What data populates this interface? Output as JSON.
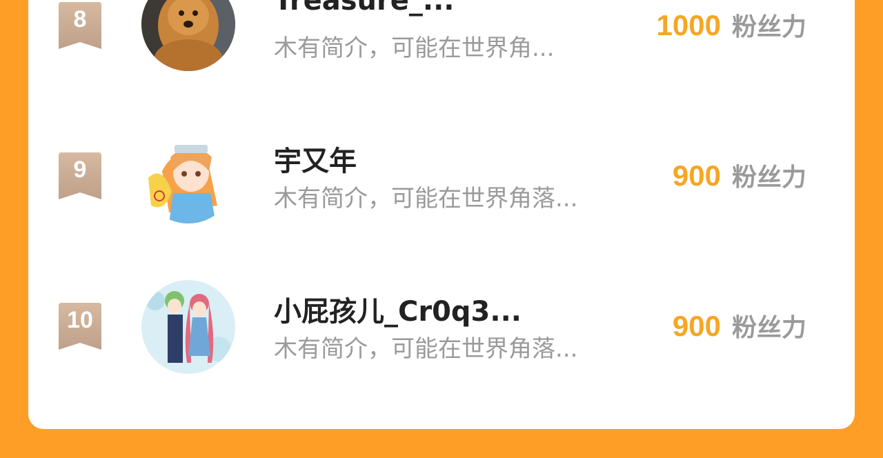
{
  "ranking": {
    "score_unit": "粉丝力",
    "colors": {
      "background": "#FF9E26",
      "score": "#F5A623",
      "badge": "#C9A98F"
    },
    "rows": [
      {
        "rank": "8",
        "name": "Treasure_...",
        "bio": "木有简介，可能在世界角...",
        "score": "1000",
        "avatar_icon": "golden-retriever-dog-avatar"
      },
      {
        "rank": "9",
        "name": "宇又年",
        "bio": "木有简介，可能在世界角落...",
        "score": "900",
        "avatar_icon": "anime-girl-avatar"
      },
      {
        "rank": "10",
        "name": "小屁孩儿_Cr0q3...",
        "bio": "木有简介，可能在世界角落...",
        "score": "900",
        "avatar_icon": "anime-couple-avatar"
      }
    ]
  }
}
